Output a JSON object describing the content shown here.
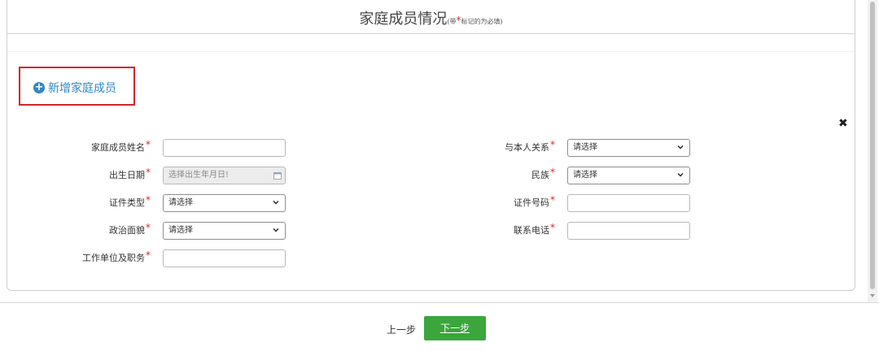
{
  "header": {
    "title": "家庭成员情况",
    "note_prefix": "(带",
    "note_star": "*",
    "note_suffix": "标记的为必填)"
  },
  "actions": {
    "add_member": "新增家庭成员"
  },
  "form": {
    "required_mark": "*",
    "left": [
      {
        "label": "家庭成员姓名",
        "type": "text",
        "value": ""
      },
      {
        "label": "出生日期",
        "type": "date",
        "placeholder": "选择出生年月日!"
      },
      {
        "label": "证件类型",
        "type": "select",
        "value": "请选择"
      },
      {
        "label": "政治面貌",
        "type": "select",
        "value": "请选择"
      },
      {
        "label": "工作单位及职务",
        "type": "text",
        "value": ""
      }
    ],
    "right": [
      {
        "label": "与本人关系",
        "type": "select",
        "value": "请选择"
      },
      {
        "label": "民族",
        "type": "select",
        "value": "请选择"
      },
      {
        "label": "证件号码",
        "type": "text",
        "value": ""
      },
      {
        "label": "联系电话",
        "type": "text",
        "value": ""
      }
    ]
  },
  "footer": {
    "prev": "上一步",
    "next": "下一步"
  },
  "colors": {
    "accent_green": "#3aa63b",
    "link_blue": "#2f87c2",
    "required_red": "#d9262b"
  }
}
